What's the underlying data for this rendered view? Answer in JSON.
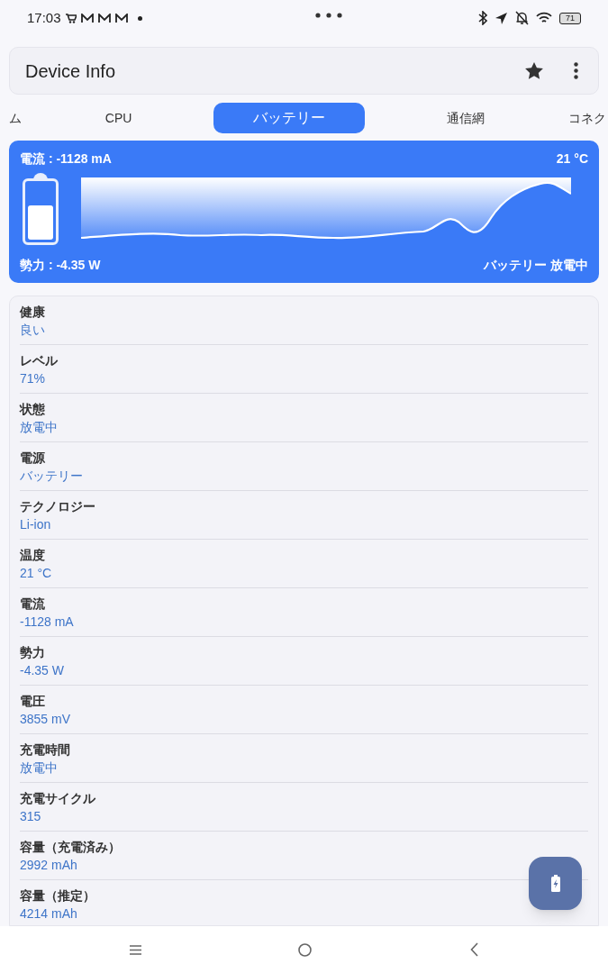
{
  "status_bar": {
    "time": "17:03",
    "battery": "71"
  },
  "app_bar": {
    "title": "Device Info"
  },
  "tabs": [
    {
      "label": "ム",
      "selected": false
    },
    {
      "label": "CPU",
      "selected": false
    },
    {
      "label": "バッテリー",
      "selected": true
    },
    {
      "label": "通信網",
      "selected": false
    },
    {
      "label": "コネク",
      "selected": false
    }
  ],
  "battery_card": {
    "current": "電流 : -1128 mA",
    "temperature": "21 °C",
    "power": "勢力 : -4.35 W",
    "status": "バッテリー 放電中",
    "level": 0.62
  },
  "details": [
    {
      "label": "健康",
      "value": "良い"
    },
    {
      "label": "レベル",
      "value": "71%"
    },
    {
      "label": "状態",
      "value": "放電中"
    },
    {
      "label": "電源",
      "value": "バッテリー"
    },
    {
      "label": "テクノロジー",
      "value": "Li-ion"
    },
    {
      "label": "温度",
      "value": "21 °C"
    },
    {
      "label": "電流",
      "value": "-1128 mA"
    },
    {
      "label": "勢力",
      "value": "-4.35 W"
    },
    {
      "label": "電圧",
      "value": "3855 mV"
    },
    {
      "label": "充電時間",
      "value": "放電中"
    },
    {
      "label": "充電サイクル",
      "value": "315"
    },
    {
      "label": "容量（充電済み）",
      "value": "2992 mAh"
    },
    {
      "label": "容量（推定）",
      "value": "4214 mAh"
    }
  ]
}
